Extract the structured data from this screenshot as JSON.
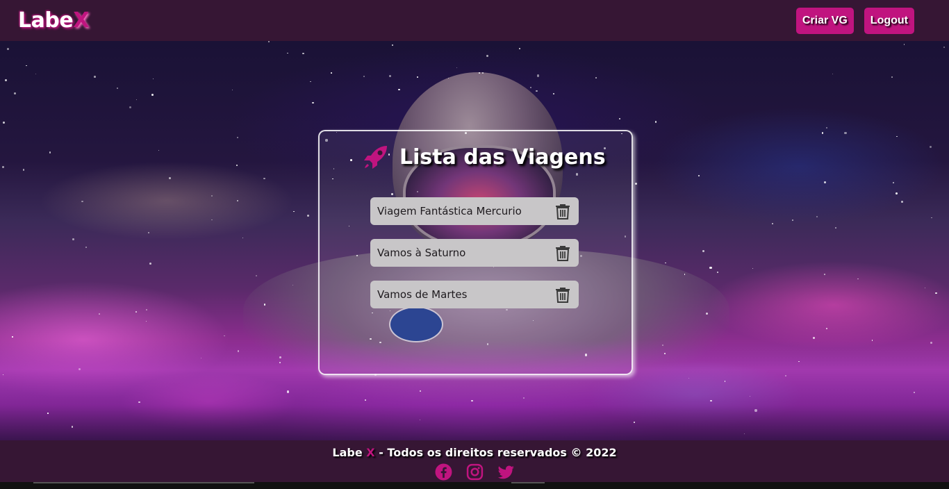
{
  "header": {
    "logo_main": "Labe",
    "logo_x": "X",
    "create_button": "Criar VG",
    "logout_button": "Logout"
  },
  "card": {
    "title": "Lista das Viagens",
    "trips": [
      {
        "name": "Viagem Fantástica Mercurio"
      },
      {
        "name": "Vamos à Saturno"
      },
      {
        "name": "Vamos de Martes"
      }
    ]
  },
  "footer": {
    "brand": "Labe",
    "brand_x": "X",
    "rights": "- Todos os direitos reservados © 2022",
    "social": [
      "facebook-icon",
      "instagram-icon",
      "twitter-icon"
    ]
  },
  "colors": {
    "header_bg": "#361634",
    "accent": "#c0147f",
    "item_bg": "#c8c6c8"
  }
}
